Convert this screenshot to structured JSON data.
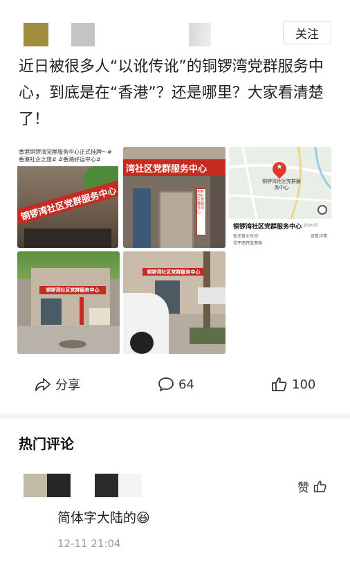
{
  "header": {
    "follow_label": "关注"
  },
  "post": {
    "text": "近日被很多人“以讹传讹”的铜锣湾党群服务中心，到底是在“香港”？还是哪里？大家看清楚了！",
    "photo1": {
      "caption": "香港铜锣湾党群服务中心正式挂牌～#香港社企之旅# #香港好运中心#",
      "sign": "铜锣湾社区党群服务中心"
    },
    "photo2": {
      "sign": "湾社区党群服务中心",
      "plaque": "铜锣湾社区党群服务中心"
    },
    "photo3": {
      "map_pin_label": "铜锣湾社区党群服务中心",
      "place_name": "铜锣湾社区党群服务中心",
      "place_tag": "营业时间",
      "place_status": "暂无营业时间",
      "place_address": "位于南开区南窑",
      "detail_link": "查看详情"
    },
    "photo4": {
      "sign": "铜锣湾社区党群服务中心"
    },
    "photo5": {
      "sign": "铜锣湾社区党群服务中心"
    }
  },
  "actions": {
    "share_label": "分享",
    "comment_count": "64",
    "like_count": "100"
  },
  "comments_section": {
    "title": "热门评论",
    "comments": [
      {
        "like_label": "赞",
        "text": "简体字大陆的",
        "emoji": "😆",
        "time": "12-11 21:04"
      }
    ]
  },
  "colors": {
    "banner_red": "#c62b22",
    "avatar_olive": "#a08d3b",
    "muted_text": "#999999"
  }
}
